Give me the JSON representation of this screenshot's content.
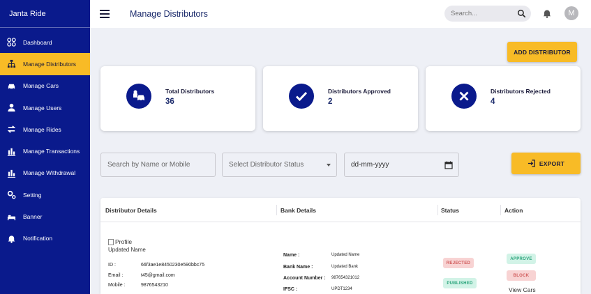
{
  "app": {
    "brand": "Janta Ride"
  },
  "sidebar": {
    "items": [
      {
        "label": "Dashboard",
        "icon": "grid-icon",
        "active": false
      },
      {
        "label": "Manage Distributors",
        "icon": "network-icon",
        "active": true
      },
      {
        "label": "Manage Cars",
        "icon": "car-icon",
        "active": false
      },
      {
        "label": "Manage Users",
        "icon": "user-icon",
        "active": false
      },
      {
        "label": "Manage Rides",
        "icon": "swap-icon",
        "active": false
      },
      {
        "label": "Manage Transactions",
        "icon": "bars-icon",
        "active": false
      },
      {
        "label": "Manage Withdrawal",
        "icon": "bars-icon",
        "active": false
      },
      {
        "label": "Setting",
        "icon": "gear-icon",
        "active": false
      },
      {
        "label": "Banner",
        "icon": "bed-icon",
        "active": false
      },
      {
        "label": "Notification",
        "icon": "bell-icon",
        "active": false
      }
    ]
  },
  "header": {
    "title": "Manage Distributors",
    "search_placeholder": "Search...",
    "avatar_initial": "M"
  },
  "toolbar": {
    "add_label": "ADD DISTRIBUTOR",
    "export_label": "EXPORT"
  },
  "stats": [
    {
      "label": "Total Distributors",
      "value": "36",
      "icon": "driver-car-icon"
    },
    {
      "label": "Distributors Approved",
      "value": "2",
      "icon": "check-icon"
    },
    {
      "label": "Distributors Rejected",
      "value": "4",
      "icon": "x-icon"
    }
  ],
  "filters": {
    "search_placeholder": "Search by Name or Mobile",
    "status_placeholder": "Select Distributor Status",
    "date_placeholder": "dd-mm-yyyy"
  },
  "table": {
    "headers": [
      "Distributor Details",
      "Bank Details",
      "Status",
      "Action"
    ],
    "row": {
      "profile_alt": "Profile",
      "name": "Updated Name",
      "id_label": "ID :",
      "id_value": "66f3ae1e8450230e590bbc75",
      "email_label": "Email :",
      "email_value": "t45@gmail.com",
      "mobile_label": "Mobile :",
      "mobile_value": "9876543210",
      "bank_name_label": "Name :",
      "bank_name_value": "Updated Name",
      "bank_bank_label": "Bank Name :",
      "bank_bank_value": "Updated Bank",
      "account_label": "Account Number :",
      "account_value": "987654321012",
      "ifsc_label": "IFSC :",
      "ifsc_value": "UPDT1234",
      "status_rejected": "REJECTED",
      "status_published": "PUBLISHED",
      "approve_label": "APPROVE",
      "block_label": "BLOCK",
      "view_cars_label": "View Cars"
    }
  },
  "colors": {
    "sidebar": "#0a1a8c",
    "accent": "#f8bb26",
    "background": "#eef0f6"
  }
}
